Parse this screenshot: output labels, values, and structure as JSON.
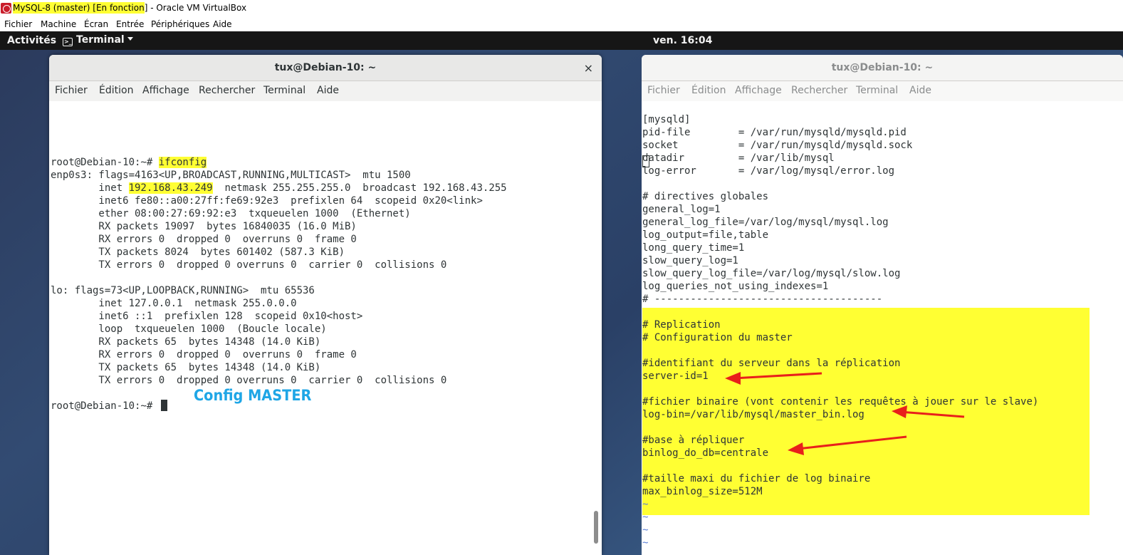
{
  "vbox": {
    "title_highlight": "MySQL-8 (master) [En fonction",
    "title_rest": "] - Oracle VM VirtualBox",
    "menu": [
      "Fichier",
      "Machine",
      "Écran",
      "Entrée",
      "Périphériques",
      "Aide"
    ]
  },
  "topbar": {
    "activities": "Activités",
    "app_menu": "Terminal",
    "clock": "ven. 16:04"
  },
  "left_terminal": {
    "title": "tux@Debian-10: ~",
    "close_glyph": "×",
    "menu": [
      "Fichier",
      "Édition",
      "Affichage",
      "Rechercher",
      "Terminal",
      "Aide"
    ],
    "prompt": "root@Debian-10:~# ",
    "command": "ifconfig",
    "lines": [
      "enp0s3: flags=4163<UP,BROADCAST,RUNNING,MULTICAST>  mtu 1500",
      "        inet ",
      "192.168.43.249",
      "  netmask 255.255.255.0  broadcast 192.168.43.255",
      "        inet6 fe80::a00:27ff:fe69:92e3  prefixlen 64  scopeid 0x20<link>",
      "        ether 08:00:27:69:92:e3  txqueuelen 1000  (Ethernet)",
      "        RX packets 19097  bytes 16840035 (16.0 MiB)",
      "        RX errors 0  dropped 0  overruns 0  frame 0",
      "        TX packets 8024  bytes 601402 (587.3 KiB)",
      "        TX errors 0  dropped 0 overruns 0  carrier 0  collisions 0",
      "lo: flags=73<UP,LOOPBACK,RUNNING>  mtu 65536",
      "        inet 127.0.0.1  netmask 255.0.0.0",
      "        inet6 ::1  prefixlen 128  scopeid 0x10<host>",
      "        loop  txqueuelen 1000  (Boucle locale)",
      "        RX packets 65  bytes 14348 (14.0 KiB)",
      "        RX errors 0  dropped 0  overruns 0  frame 0",
      "        TX packets 65  bytes 14348 (14.0 KiB)",
      "        TX errors 0  dropped 0 overruns 0  carrier 0  collisions 0"
    ],
    "final_prompt": "root@Debian-10:~# ",
    "annotation": "Config MASTER"
  },
  "right_terminal": {
    "title": "tux@Debian-10: ~",
    "menu": [
      "Fichier",
      "Édition",
      "Affichage",
      "Rechercher",
      "Terminal",
      "Aide"
    ],
    "lines": [
      "[mysqld]",
      "pid-file        = /var/run/mysqld/mysqld.pid",
      "socket          = /var/run/mysqld/mysqld.sock",
      "datadir         = /var/lib/mysql",
      "log-error       = /var/log/mysql/error.log",
      "# directives globales",
      "general_log=1",
      "general_log_file=/var/log/mysql/mysql.log",
      "log_output=file,table",
      "long_query_time=1",
      "slow_query_log=1",
      "slow_query_log_file=/var/log/mysql/slow.log",
      "log_queries_not_using_indexes=1",
      "# --------------------------------------",
      "# Replication",
      "# Configuration du master",
      "#identifiant du serveur dans la réplication",
      "server-id=1",
      "#fichier binaire (vont contenir les requêtes à jouer sur le slave)",
      "log-bin=/var/lib/mysql/master_bin.log",
      "#base à répliquer",
      "binlog_do_db=centrale",
      "#taille maxi du fichier de log binaire",
      "max_binlog_size=512M",
      "~"
    ]
  },
  "colors": {
    "highlight": "#ffff33",
    "arrow": "#e8201b",
    "annotation": "#1fa6e6",
    "topbar": "#161616"
  }
}
